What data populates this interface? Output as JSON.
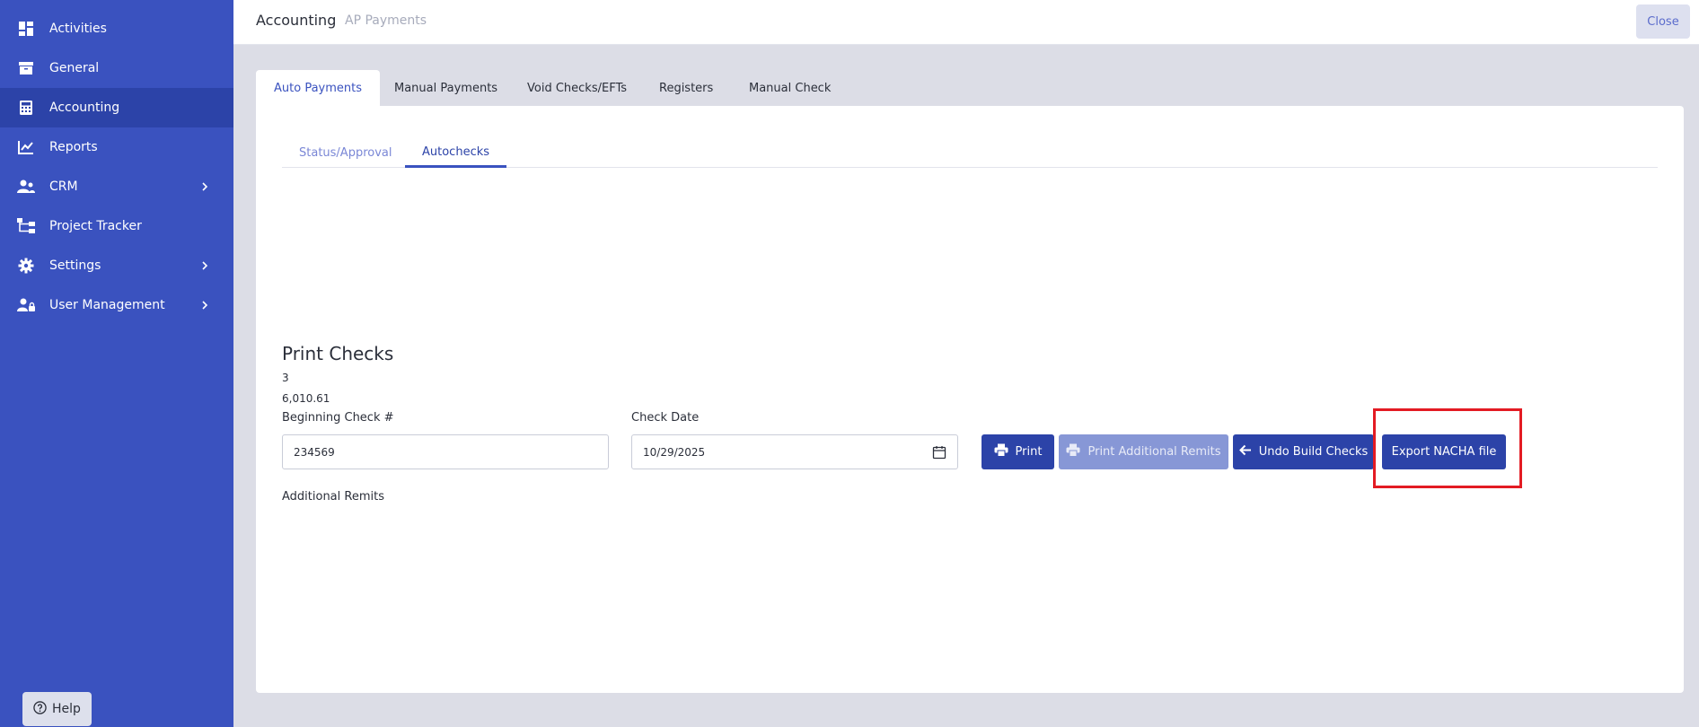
{
  "sidebar": {
    "items": [
      {
        "label": "Activities",
        "icon": "dashboard-icon"
      },
      {
        "label": "General",
        "icon": "archive-icon"
      },
      {
        "label": "Accounting",
        "icon": "calculator-icon",
        "active": true
      },
      {
        "label": "Reports",
        "icon": "chart-line-icon"
      },
      {
        "label": "CRM",
        "icon": "users-icon",
        "has_submenu": true
      },
      {
        "label": "Project Tracker",
        "icon": "sitemap-icon"
      },
      {
        "label": "Settings",
        "icon": "gear-icon",
        "has_submenu": true
      },
      {
        "label": "User Management",
        "icon": "user-lock-icon",
        "has_submenu": true
      }
    ],
    "help_label": "Help"
  },
  "header": {
    "title": "Accounting",
    "subtitle": "AP Payments",
    "close_label": "Close"
  },
  "main_tabs": [
    {
      "label": "Auto Payments",
      "active": true
    },
    {
      "label": "Manual Payments"
    },
    {
      "label": "Void Checks/EFTs"
    },
    {
      "label": "Registers"
    },
    {
      "label": "Manual Check"
    }
  ],
  "sub_tabs": [
    {
      "label": "Status/Approval"
    },
    {
      "label": "Autochecks",
      "active": true
    }
  ],
  "print_checks": {
    "title": "Print Checks",
    "count": "3",
    "total": "6,010.61",
    "beginning_check_label": "Beginning Check #",
    "beginning_check_value": "234569",
    "check_date_label": "Check Date",
    "check_date_value": "10/29/2025",
    "buttons": {
      "print": "Print",
      "print_additional_remits": "Print Additional Remits",
      "undo_build_checks": "Undo Build Checks",
      "export_nacha": "Export NACHA file"
    },
    "additional_remits_label": "Additional Remits"
  },
  "colors": {
    "sidebar": "#3a52bf",
    "sidebar_active": "#2c43a8",
    "primary_button": "#2c43a8",
    "disabled_button": "#8797d6",
    "highlight": "#e31b23"
  }
}
